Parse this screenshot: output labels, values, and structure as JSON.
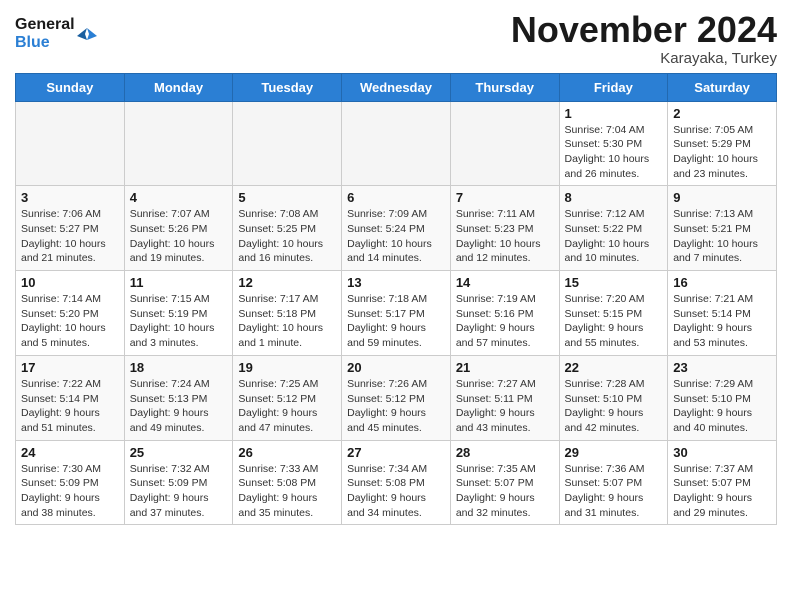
{
  "header": {
    "logo_line1": "General",
    "logo_line2": "Blue",
    "month": "November 2024",
    "location": "Karayaka, Turkey"
  },
  "weekdays": [
    "Sunday",
    "Monday",
    "Tuesday",
    "Wednesday",
    "Thursday",
    "Friday",
    "Saturday"
  ],
  "weeks": [
    [
      {
        "day": "",
        "info": ""
      },
      {
        "day": "",
        "info": ""
      },
      {
        "day": "",
        "info": ""
      },
      {
        "day": "",
        "info": ""
      },
      {
        "day": "",
        "info": ""
      },
      {
        "day": "1",
        "info": "Sunrise: 7:04 AM\nSunset: 5:30 PM\nDaylight: 10 hours\nand 26 minutes."
      },
      {
        "day": "2",
        "info": "Sunrise: 7:05 AM\nSunset: 5:29 PM\nDaylight: 10 hours\nand 23 minutes."
      }
    ],
    [
      {
        "day": "3",
        "info": "Sunrise: 7:06 AM\nSunset: 5:27 PM\nDaylight: 10 hours\nand 21 minutes."
      },
      {
        "day": "4",
        "info": "Sunrise: 7:07 AM\nSunset: 5:26 PM\nDaylight: 10 hours\nand 19 minutes."
      },
      {
        "day": "5",
        "info": "Sunrise: 7:08 AM\nSunset: 5:25 PM\nDaylight: 10 hours\nand 16 minutes."
      },
      {
        "day": "6",
        "info": "Sunrise: 7:09 AM\nSunset: 5:24 PM\nDaylight: 10 hours\nand 14 minutes."
      },
      {
        "day": "7",
        "info": "Sunrise: 7:11 AM\nSunset: 5:23 PM\nDaylight: 10 hours\nand 12 minutes."
      },
      {
        "day": "8",
        "info": "Sunrise: 7:12 AM\nSunset: 5:22 PM\nDaylight: 10 hours\nand 10 minutes."
      },
      {
        "day": "9",
        "info": "Sunrise: 7:13 AM\nSunset: 5:21 PM\nDaylight: 10 hours\nand 7 minutes."
      }
    ],
    [
      {
        "day": "10",
        "info": "Sunrise: 7:14 AM\nSunset: 5:20 PM\nDaylight: 10 hours\nand 5 minutes."
      },
      {
        "day": "11",
        "info": "Sunrise: 7:15 AM\nSunset: 5:19 PM\nDaylight: 10 hours\nand 3 minutes."
      },
      {
        "day": "12",
        "info": "Sunrise: 7:17 AM\nSunset: 5:18 PM\nDaylight: 10 hours\nand 1 minute."
      },
      {
        "day": "13",
        "info": "Sunrise: 7:18 AM\nSunset: 5:17 PM\nDaylight: 9 hours\nand 59 minutes."
      },
      {
        "day": "14",
        "info": "Sunrise: 7:19 AM\nSunset: 5:16 PM\nDaylight: 9 hours\nand 57 minutes."
      },
      {
        "day": "15",
        "info": "Sunrise: 7:20 AM\nSunset: 5:15 PM\nDaylight: 9 hours\nand 55 minutes."
      },
      {
        "day": "16",
        "info": "Sunrise: 7:21 AM\nSunset: 5:14 PM\nDaylight: 9 hours\nand 53 minutes."
      }
    ],
    [
      {
        "day": "17",
        "info": "Sunrise: 7:22 AM\nSunset: 5:14 PM\nDaylight: 9 hours\nand 51 minutes."
      },
      {
        "day": "18",
        "info": "Sunrise: 7:24 AM\nSunset: 5:13 PM\nDaylight: 9 hours\nand 49 minutes."
      },
      {
        "day": "19",
        "info": "Sunrise: 7:25 AM\nSunset: 5:12 PM\nDaylight: 9 hours\nand 47 minutes."
      },
      {
        "day": "20",
        "info": "Sunrise: 7:26 AM\nSunset: 5:12 PM\nDaylight: 9 hours\nand 45 minutes."
      },
      {
        "day": "21",
        "info": "Sunrise: 7:27 AM\nSunset: 5:11 PM\nDaylight: 9 hours\nand 43 minutes."
      },
      {
        "day": "22",
        "info": "Sunrise: 7:28 AM\nSunset: 5:10 PM\nDaylight: 9 hours\nand 42 minutes."
      },
      {
        "day": "23",
        "info": "Sunrise: 7:29 AM\nSunset: 5:10 PM\nDaylight: 9 hours\nand 40 minutes."
      }
    ],
    [
      {
        "day": "24",
        "info": "Sunrise: 7:30 AM\nSunset: 5:09 PM\nDaylight: 9 hours\nand 38 minutes."
      },
      {
        "day": "25",
        "info": "Sunrise: 7:32 AM\nSunset: 5:09 PM\nDaylight: 9 hours\nand 37 minutes."
      },
      {
        "day": "26",
        "info": "Sunrise: 7:33 AM\nSunset: 5:08 PM\nDaylight: 9 hours\nand 35 minutes."
      },
      {
        "day": "27",
        "info": "Sunrise: 7:34 AM\nSunset: 5:08 PM\nDaylight: 9 hours\nand 34 minutes."
      },
      {
        "day": "28",
        "info": "Sunrise: 7:35 AM\nSunset: 5:07 PM\nDaylight: 9 hours\nand 32 minutes."
      },
      {
        "day": "29",
        "info": "Sunrise: 7:36 AM\nSunset: 5:07 PM\nDaylight: 9 hours\nand 31 minutes."
      },
      {
        "day": "30",
        "info": "Sunrise: 7:37 AM\nSunset: 5:07 PM\nDaylight: 9 hours\nand 29 minutes."
      }
    ]
  ]
}
